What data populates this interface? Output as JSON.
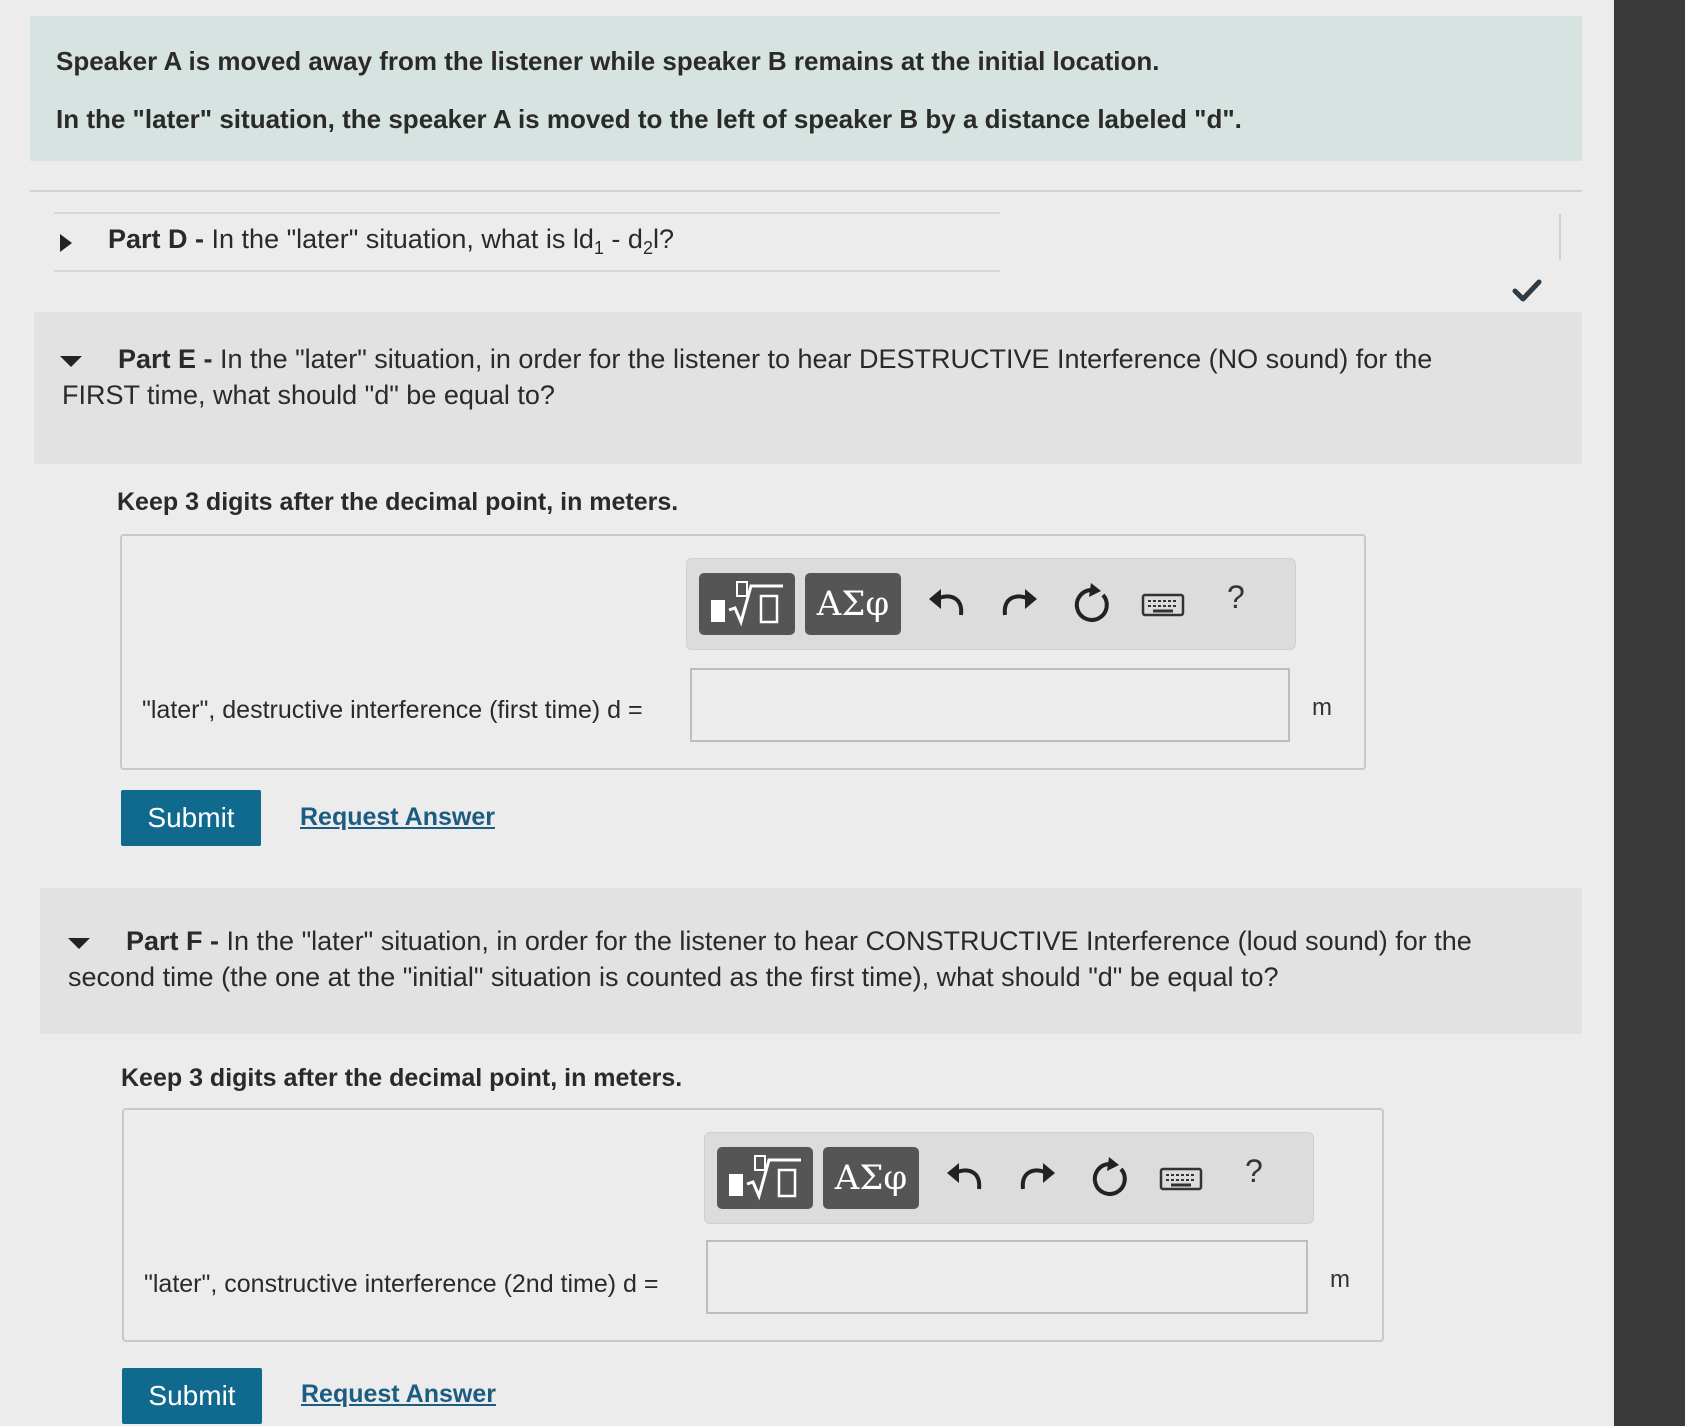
{
  "intro": {
    "line1": "Speaker A is moved away from the listener while speaker B remains at the initial location.",
    "line2": "In the \"later\" situation, the speaker A is moved to the left of speaker B by a distance labeled \"d\"."
  },
  "partD": {
    "label": "Part D -",
    "text_a": " In the \"later\" situation, what is ld",
    "sub1": "1",
    "text_b": " - d",
    "sub2": "2",
    "text_c": "l?",
    "icon": "check-icon"
  },
  "partE": {
    "label": "Part E -",
    "question_line1": " In the \"later\" situation, in order for the listener to hear DESTRUCTIVE Interference (NO sound)  for the",
    "question_line2": "FIRST time, what should \"d\" be equal to?",
    "instruction": "Keep 3 digits after the decimal point, in meters.",
    "toolbar": {
      "greek": "ΑΣφ",
      "help": "?"
    },
    "field_label": "\"later\", destructive interference (first time)  d =",
    "field_value": "",
    "unit": "m",
    "submit": "Submit",
    "request": "Request Answer"
  },
  "partF": {
    "label": "Part F -",
    "question_line1": " In the \"later\" situation, in order for the listener to hear CONSTRUCTIVE Interference (loud sound) for the",
    "question_line2": "second time (the one at the \"initial\" situation is counted as the first time), what should \"d\" be equal to?",
    "instruction": "Keep 3 digits after the decimal point, in meters.",
    "toolbar": {
      "greek": "ΑΣφ",
      "help": "?"
    },
    "field_label": "\"later\", constructive interference (2nd time)  d =",
    "field_value": "",
    "unit": "m",
    "submit": "Submit",
    "request": "Request Answer"
  },
  "colors": {
    "accent": "#0f6a8e",
    "intro_bg": "#d7e3e0",
    "toolbar_button": "#555555"
  }
}
